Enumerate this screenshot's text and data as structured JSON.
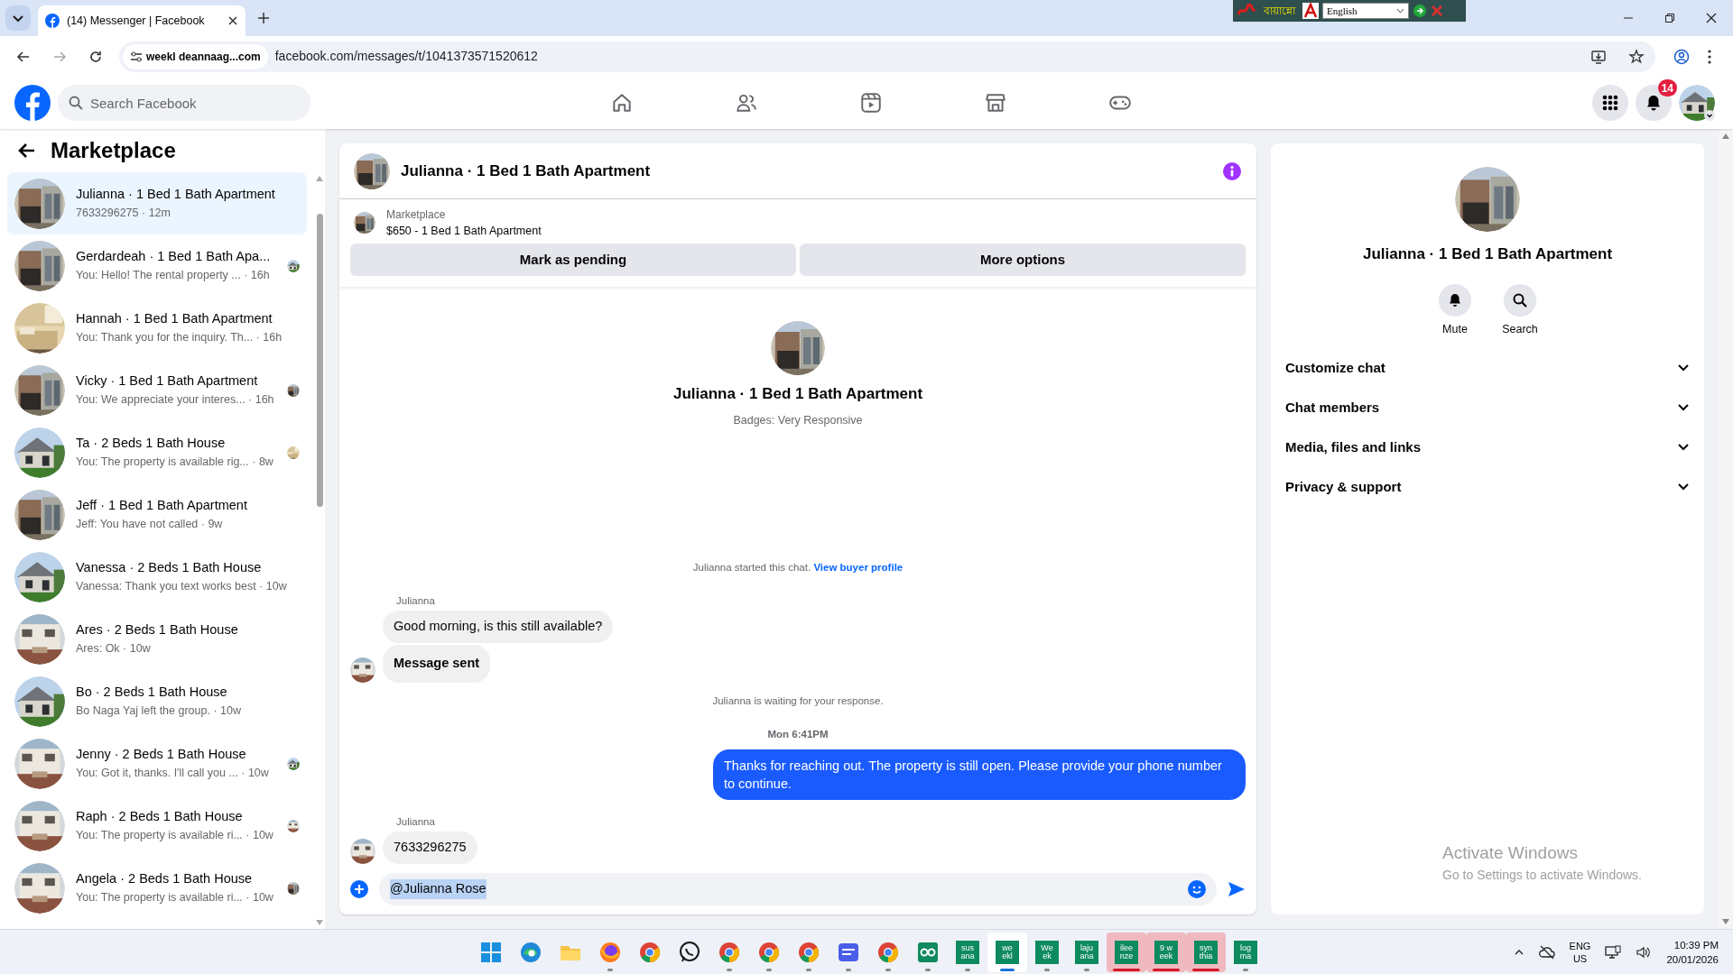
{
  "browser": {
    "tab_title": "(14) Messenger | Facebook",
    "site_chip": "weekl deannaag...com",
    "url": "facebook.com/messages/t/1041373571520612",
    "language_bar": {
      "script_text": "বায়ান্নো",
      "language": "English"
    }
  },
  "fb_header": {
    "search_placeholder": "Search Facebook",
    "nav": [
      {
        "kind": "home",
        "selected": false
      },
      {
        "kind": "friends",
        "selected": false
      },
      {
        "kind": "video",
        "selected": false
      },
      {
        "kind": "marketplace",
        "selected": false
      },
      {
        "kind": "gaming",
        "selected": false
      }
    ],
    "notification_count": "14"
  },
  "sidebar": {
    "title": "Marketplace",
    "conversations": [
      {
        "title": "Julianna · 1 Bed 1 Bath Apartment",
        "subtitle": "7633296275 · 12m",
        "selected": true,
        "seen": false
      },
      {
        "title": "Gerdardeah · 1 Bed 1 Bath Apa...",
        "subtitle": "You: Hello! The rental property ... · 16h",
        "selected": false,
        "seen": true
      },
      {
        "title": "Hannah · 1 Bed 1 Bath Apartment",
        "subtitle": "You: Thank you for the inquiry. Th... · 16h",
        "selected": false,
        "seen": false
      },
      {
        "title": "Vicky · 1 Bed 1 Bath Apartment",
        "subtitle": "You: We appreciate your interes... · 16h",
        "selected": false,
        "seen": true
      },
      {
        "title": "Ta · 2 Beds 1 Bath House",
        "subtitle": "You: The property is available rig... · 8w",
        "selected": false,
        "seen": true
      },
      {
        "title": "Jeff · 1 Bed 1 Bath Apartment",
        "subtitle": "Jeff: You have not called · 9w",
        "selected": false,
        "seen": false
      },
      {
        "title": "Vanessa · 2 Beds 1 Bath House",
        "subtitle": "Vanessa: Thank you text works best · 10w",
        "selected": false,
        "seen": false
      },
      {
        "title": "Ares · 2 Beds 1 Bath House",
        "subtitle": "Ares: Ok · 10w",
        "selected": false,
        "seen": false
      },
      {
        "title": "Bo · 2 Beds 1 Bath House",
        "subtitle": "Bo Naga Yaj left the group. · 10w",
        "selected": false,
        "seen": false
      },
      {
        "title": "Jenny · 2 Beds 1 Bath House",
        "subtitle": "You: Got it, thanks. I'll call you ... · 10w",
        "selected": false,
        "seen": true
      },
      {
        "title": "Raph · 2 Beds 1 Bath House",
        "subtitle": "You: The property is available ri... · 10w",
        "selected": false,
        "seen": true
      },
      {
        "title": "Angela · 2 Beds 1 Bath House",
        "subtitle": "You: The property is available ri... · 10w",
        "selected": false,
        "seen": true
      }
    ]
  },
  "chat": {
    "title": "Julianna · 1 Bed 1 Bath Apartment",
    "listing": {
      "label": "Marketplace",
      "title": "$650 - 1 Bed 1 Bath Apartment"
    },
    "buttons": [
      "Mark as pending",
      "More options"
    ],
    "intro": {
      "title": "Julianna · 1 Bed 1 Bath Apartment",
      "badges": "Badges: Very Responsive"
    },
    "messages": [
      {
        "kind": "notice",
        "text": "Julianna started this chat.",
        "link": "View buyer profile"
      },
      {
        "kind": "sender",
        "text": "Julianna"
      },
      {
        "kind": "incoming",
        "text": "Good morning, is this still available?",
        "bold": false,
        "avatar": false
      },
      {
        "kind": "incoming",
        "text": "Message sent",
        "bold": true,
        "avatar": true
      },
      {
        "kind": "notice",
        "text": "Julianna is waiting for your response."
      },
      {
        "kind": "timestamp",
        "text": "Mon 6:41PM"
      },
      {
        "kind": "outgoing",
        "text": "Thanks for reaching out. The property is still open. Please provide your phone number to continue."
      },
      {
        "kind": "sender",
        "text": "Julianna"
      },
      {
        "kind": "incoming",
        "text": "7633296275",
        "bold": false,
        "avatar": true
      }
    ],
    "composer": {
      "value": "@Julianna Rose"
    }
  },
  "details": {
    "title": "Julianna · 1 Bed 1 Bath Apartment",
    "actions": [
      {
        "kind": "mute",
        "label": "Mute"
      },
      {
        "kind": "search",
        "label": "Search"
      }
    ],
    "sections": [
      {
        "label": "Customize chat",
        "expanded": false
      },
      {
        "label": "Chat members",
        "expanded": false
      },
      {
        "label": "Media, files and links",
        "expanded": false
      },
      {
        "label": "Privacy & support",
        "expanded": false
      }
    ]
  },
  "activation_notice": {
    "title": "Activate Windows",
    "text": "Go to Settings to activate Windows."
  },
  "taskbar": {
    "apps": [
      {
        "kind": "windows",
        "running": false,
        "active": false,
        "alert": false
      },
      {
        "kind": "edge",
        "running": false,
        "active": false,
        "alert": false
      },
      {
        "kind": "folder",
        "running": false,
        "active": false,
        "alert": false
      },
      {
        "kind": "firefox",
        "running": true,
        "active": false,
        "alert": false
      },
      {
        "kind": "chrome",
        "running": false,
        "active": false,
        "alert": false
      },
      {
        "kind": "whatsapp",
        "running": false,
        "active": false,
        "alert": false
      },
      {
        "kind": "chrome",
        "running": true,
        "active": false,
        "alert": false
      },
      {
        "kind": "chrome",
        "running": true,
        "active": false,
        "alert": false
      },
      {
        "kind": "chrome",
        "running": true,
        "active": false,
        "alert": false
      },
      {
        "kind": "proxy",
        "running": true,
        "active": false,
        "alert": false
      },
      {
        "kind": "chrome",
        "running": true,
        "active": false,
        "alert": false
      },
      {
        "kind": "loop",
        "running": true,
        "active": false,
        "alert": false
      },
      {
        "kind": "tile",
        "lines": [
          "sus",
          "ana"
        ],
        "running": true,
        "active": false,
        "alert": false
      },
      {
        "kind": "tile",
        "lines": [
          "we",
          "ekl"
        ],
        "running": true,
        "active": true,
        "alert": false
      },
      {
        "kind": "tile",
        "lines": [
          "We",
          "ek"
        ],
        "running": true,
        "active": false,
        "alert": false
      },
      {
        "kind": "tile",
        "lines": [
          "laju",
          "ana"
        ],
        "running": true,
        "active": false,
        "alert": false
      },
      {
        "kind": "tile",
        "lines": [
          "ilee",
          "nze"
        ],
        "running": true,
        "active": false,
        "alert": true
      },
      {
        "kind": "tile",
        "lines": [
          "9 w",
          "eek"
        ],
        "running": true,
        "active": false,
        "alert": true
      },
      {
        "kind": "tile",
        "lines": [
          "syn",
          "thia"
        ],
        "running": true,
        "active": false,
        "alert": true
      },
      {
        "kind": "tile",
        "lines": [
          "log",
          "ma"
        ],
        "running": true,
        "active": false,
        "alert": false
      }
    ],
    "language": [
      "ENG",
      "US"
    ],
    "time": "10:39 PM",
    "date": "20/01/2026"
  }
}
